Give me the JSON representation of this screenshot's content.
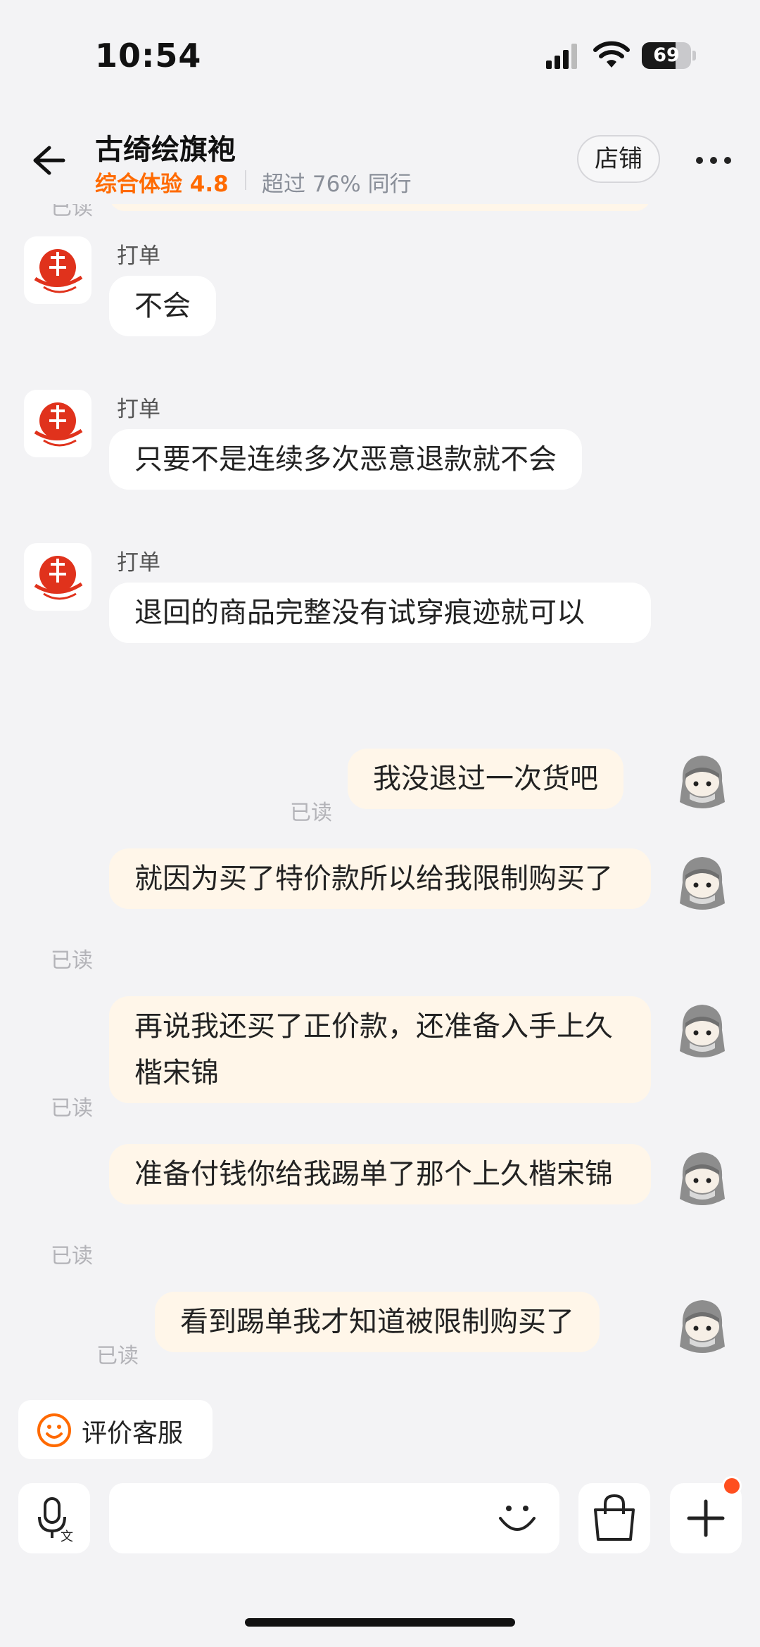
{
  "status_bar": {
    "time": "10:54",
    "battery": "69",
    "battery_level": 0.69,
    "icons": [
      "signal-icon",
      "wifi-icon",
      "battery-icon"
    ]
  },
  "header": {
    "title": "古绮绘旗袍",
    "rating": "综合体验 4.8",
    "rank": "超过 76% 同行",
    "store_button": "店铺",
    "icons": [
      "back-arrow-icon",
      "more-icon"
    ],
    "accent_color": "#ff6a00"
  },
  "chat": {
    "top_read": "已读",
    "messages": [
      {
        "from": "shop",
        "sender": "打单",
        "text": "不会"
      },
      {
        "from": "shop",
        "sender": "打单",
        "text": "只要不是连续多次恶意退款就不会"
      },
      {
        "from": "shop",
        "sender": "打单",
        "text": "退回的商品完整没有试穿痕迹就可以"
      },
      {
        "from": "user",
        "text": "我没退过一次货吧",
        "status": "已读"
      },
      {
        "from": "user",
        "text": "就因为买了特价款所以给我限制购买了",
        "status": "已读"
      },
      {
        "from": "user",
        "text": "再说我还买了正价款，还准备入手上久楷宋锦",
        "status": "已读"
      },
      {
        "from": "user",
        "text": "准备付钱你给我踢单了那个上久楷宋锦",
        "status": "已读"
      },
      {
        "from": "user",
        "text": "看到踢单我才知道被限制购买了",
        "status": "已读"
      }
    ]
  },
  "rate_service": {
    "label": "评价客服",
    "icon": "smile-icon"
  },
  "input_bar": {
    "placeholder": "",
    "icons": [
      "voice-icon",
      "emoji-icon",
      "shopping-bag-icon",
      "plus-icon"
    ],
    "badge_color": "#ff4f1f"
  }
}
